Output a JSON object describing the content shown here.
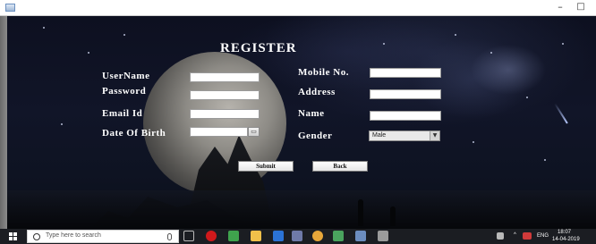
{
  "window": {
    "min_glyph": "–",
    "max_glyph": "□"
  },
  "form": {
    "title": "REGISTER",
    "labels": {
      "username": "UserName",
      "password": "Password",
      "email": "Email Id",
      "dob": "Date Of Birth",
      "mobile": "Mobile No.",
      "address": "Address",
      "name": "Name",
      "gender": "Gender"
    },
    "gender_selected": "Male",
    "submit_label": "Submit",
    "back_label": "Back"
  },
  "taskbar": {
    "search_placeholder": "Type here to search",
    "language": "ENG",
    "time": "18:07",
    "date": "14-04-2019"
  }
}
